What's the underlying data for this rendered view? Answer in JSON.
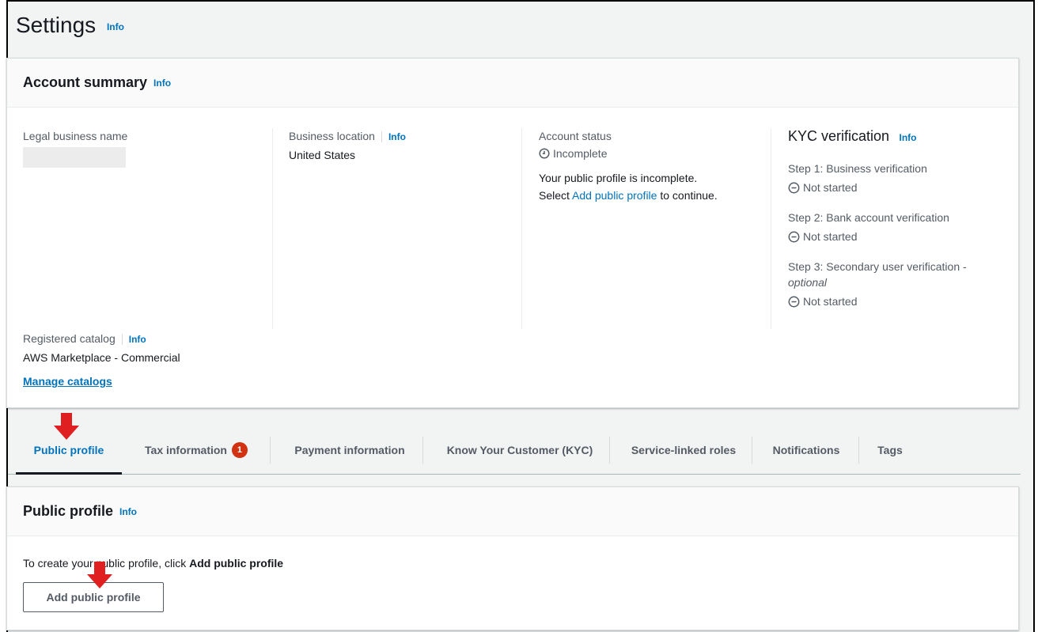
{
  "page": {
    "title": "Settings",
    "info_label": "Info"
  },
  "summary": {
    "title": "Account summary",
    "info_label": "Info",
    "legal_name": {
      "label": "Legal business name"
    },
    "business_location": {
      "label": "Business location",
      "info_label": "Info",
      "value": "United States"
    },
    "account_status": {
      "label": "Account status",
      "status": "Incomplete",
      "message_line1": "Your public profile is incomplete.",
      "message_select": "Select",
      "message_link": "Add public profile",
      "message_end": "to continue."
    },
    "kyc": {
      "title": "KYC verification",
      "info_label": "Info",
      "steps": [
        {
          "label": "Step 1: Business verification",
          "status": "Not started"
        },
        {
          "label": "Step 2: Bank account verification",
          "status": "Not started"
        },
        {
          "label": "Step 3: Secondary user verification -",
          "label_suffix": "optional",
          "status": "Not started"
        }
      ]
    },
    "registered_catalog": {
      "label": "Registered catalog",
      "info_label": "Info",
      "value": "AWS Marketplace - Commercial",
      "manage_link": "Manage catalogs"
    }
  },
  "tabs": {
    "items": [
      {
        "label": "Public profile",
        "active": true
      },
      {
        "label": "Tax information",
        "badge": "1"
      },
      {
        "label": "Payment information"
      },
      {
        "label": "Know Your Customer (KYC)"
      },
      {
        "label": "Service-linked roles"
      },
      {
        "label": "Notifications"
      },
      {
        "label": "Tags"
      }
    ]
  },
  "public_profile": {
    "title": "Public profile",
    "info_label": "Info",
    "instruction_prefix": "To create your public profile, click",
    "instruction_bold": "Add public profile",
    "button_label": "Add public profile"
  },
  "colors": {
    "link": "#0073bb",
    "badge": "#d13212",
    "annotation_arrow": "#e02020"
  }
}
